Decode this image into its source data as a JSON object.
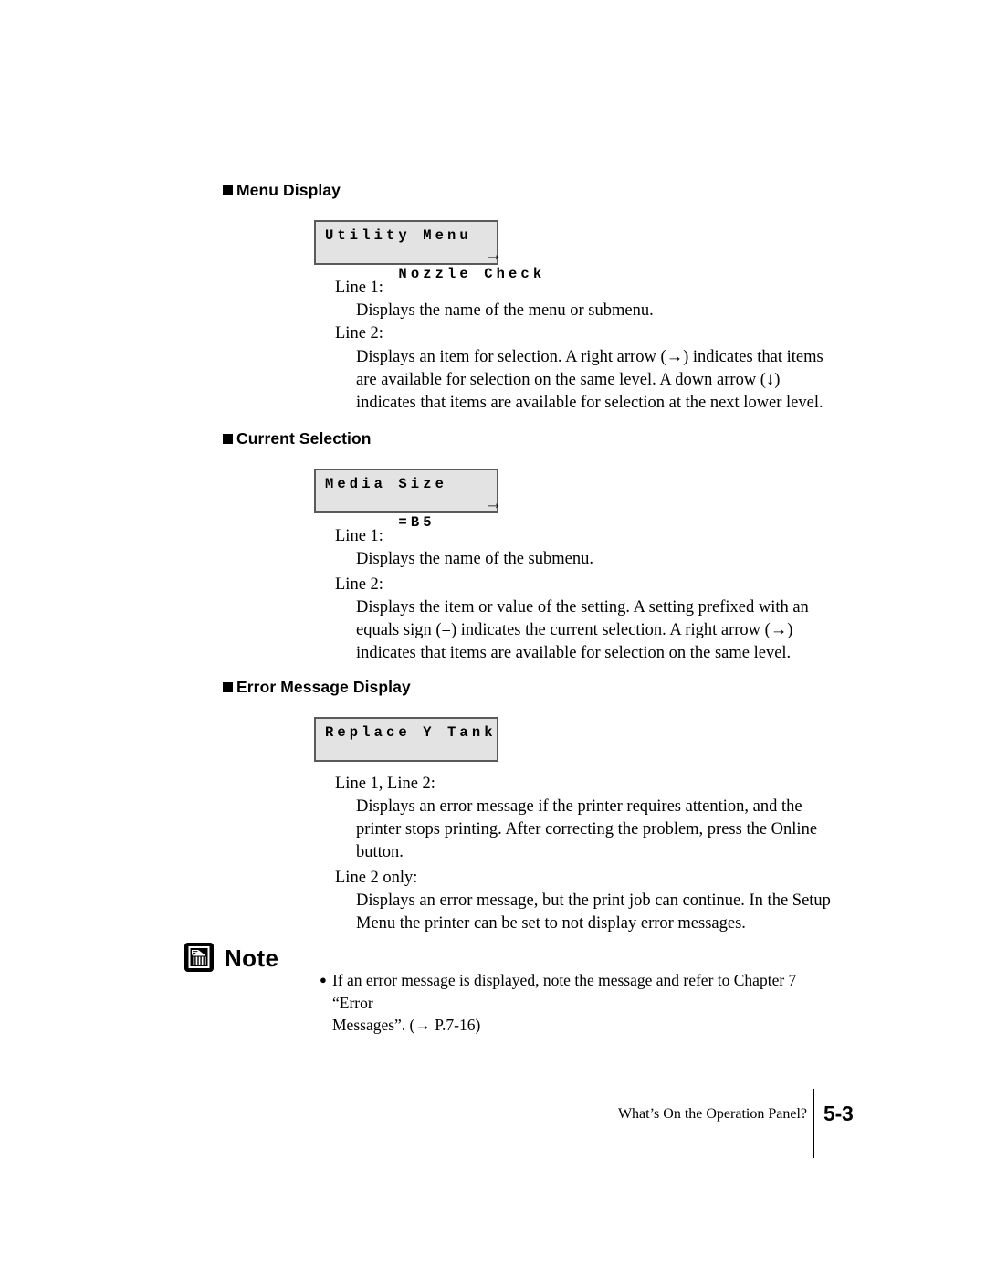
{
  "sections": [
    {
      "heading": "Menu Display",
      "lcd": {
        "line1": "Utility Menu",
        "line2": "Nozzle Check",
        "arrow": "→"
      },
      "entries": [
        {
          "term": "Line 1:",
          "lines": [
            "Displays the name of the menu or submenu."
          ]
        },
        {
          "term": "Line 2:",
          "lines": [
            "Displays an item for selection. A right arrow (→) indicates that items",
            "are available for selection on the same level. A down arrow (↓)",
            "indicates that items are available for selection at the next lower level."
          ]
        }
      ]
    },
    {
      "heading": "Current Selection",
      "lcd": {
        "line1": "Media Size",
        "line2": "=B5",
        "arrow": "→"
      },
      "entries": [
        {
          "term": "Line 1:",
          "lines": [
            "Displays the name of the submenu."
          ]
        },
        {
          "term": "Line 2:",
          "lines": [
            "Displays the item or value of the setting. A setting prefixed with an",
            "equals sign (=) indicates the current selection. A right arrow (→)",
            "indicates that items are available for selection on the same level."
          ]
        }
      ]
    },
    {
      "heading": "Error Message Display",
      "lcd": {
        "line1": "Replace Y Tank",
        "line2": "",
        "arrow": ""
      },
      "entries": [
        {
          "term": "Line 1, Line 2:",
          "lines": [
            "Displays an error message if the printer requires attention, and the",
            "printer stops printing. After correcting the problem, press the Online",
            "button."
          ]
        },
        {
          "term": "Line 2 only:",
          "lines": [
            "Displays an error message, but the print job can continue. In the Setup",
            "Menu the printer can be set to not display error messages."
          ]
        }
      ]
    }
  ],
  "note": {
    "label": "Note",
    "icon": "note-memo-icon",
    "bullet_line1": "If an error message is displayed, note the message and refer to Chapter 7 “Error",
    "bullet_line2": "Messages”. (→ P.7-16)"
  },
  "footer": {
    "chapter_title": "What’s On the Operation Panel?",
    "page_number": "5-3"
  },
  "colors": {
    "lcd_background": "#e3e3e3",
    "lcd_border": "#5a5a5a",
    "text": "#000000",
    "page_background": "#ffffff"
  }
}
